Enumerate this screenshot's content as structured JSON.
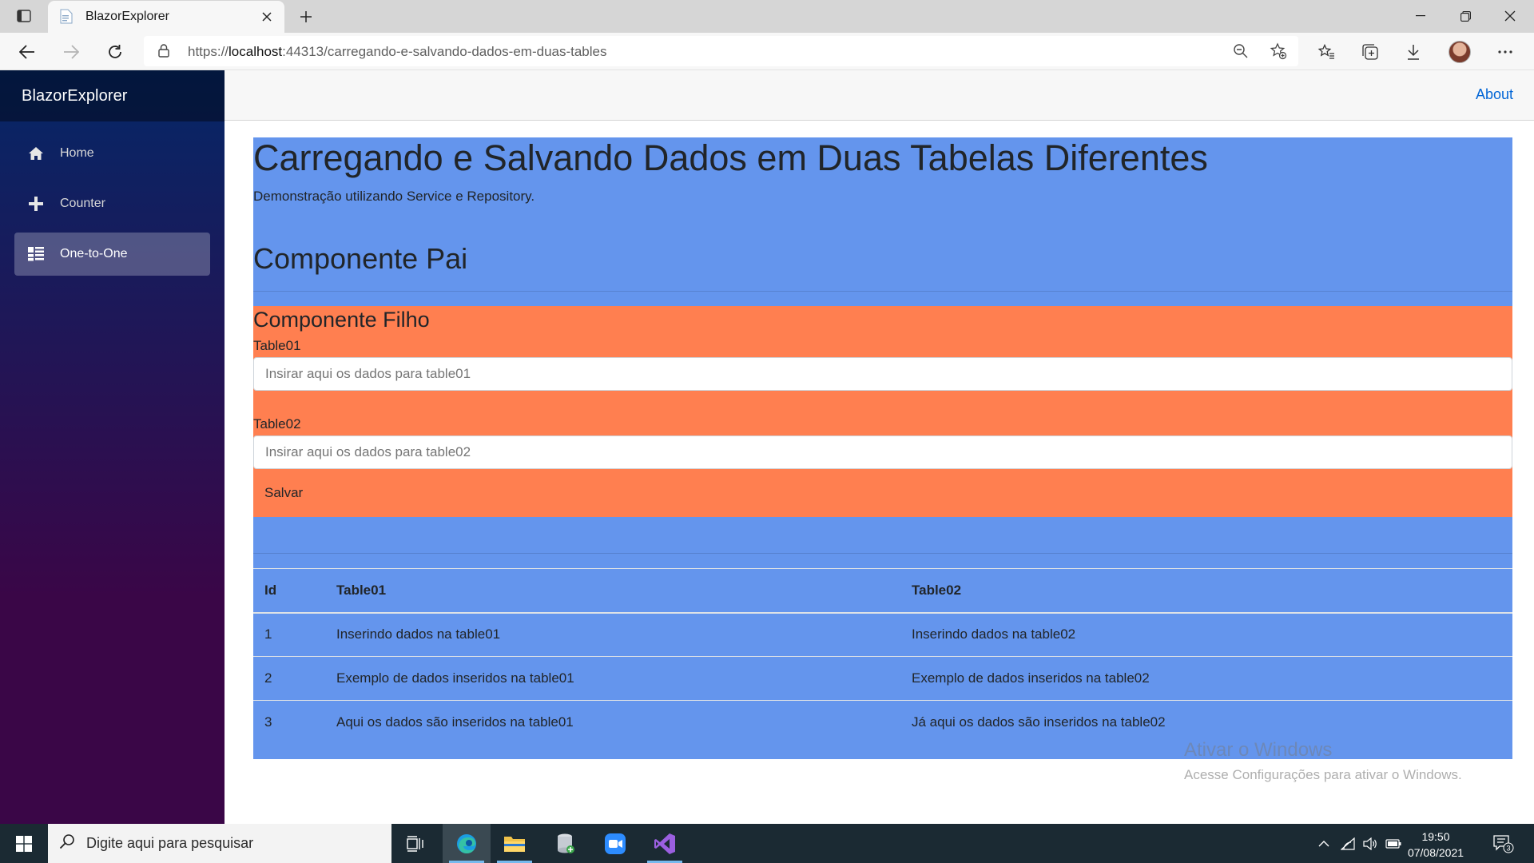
{
  "browser": {
    "tab_title": "BlazorExplorer",
    "url_prefix": "https://",
    "url_host": "localhost",
    "url_rest": ":44313/carregando-e-salvando-dados-em-duas-tables"
  },
  "app": {
    "brand": "BlazorExplorer",
    "nav": [
      {
        "label": "Home",
        "icon": "home-icon",
        "active": false
      },
      {
        "label": "Counter",
        "icon": "plus-icon",
        "active": false
      },
      {
        "label": "One-to-One",
        "icon": "list-icon",
        "active": true
      }
    ],
    "about_link": "About"
  },
  "page": {
    "title": "Carregando e Salvando Dados em Duas Tabelas Diferentes",
    "subtitle": "Demonstração utilizando Service e Repository.",
    "parent_heading": "Componente Pai",
    "child_heading": "Componente Filho",
    "table01_label": "Table01",
    "table01_placeholder": "Insirar aqui os dados para table01",
    "table02_label": "Table02",
    "table02_placeholder": "Insirar aqui os dados para table02",
    "save_label": "Salvar",
    "parent_color": "#6495ed",
    "child_color": "#ff7f50"
  },
  "table": {
    "headers": [
      "Id",
      "Table01",
      "Table02"
    ],
    "rows": [
      [
        "1",
        "Inserindo dados na table01",
        "Inserindo dados na table02"
      ],
      [
        "2",
        "Exemplo de dados inseridos na table01",
        "Exemplo de dados inseridos na table02"
      ],
      [
        "3",
        "Aqui os dados são inseridos na table01",
        "Já aqui os dados são inseridos na table02"
      ]
    ]
  },
  "watermark": {
    "line1": "Ativar o Windows",
    "line2": "Acesse Configurações para ativar o Windows."
  },
  "taskbar": {
    "search_placeholder": "Digite aqui para pesquisar",
    "time": "19:50",
    "date": "07/08/2021",
    "notifications": "3"
  }
}
